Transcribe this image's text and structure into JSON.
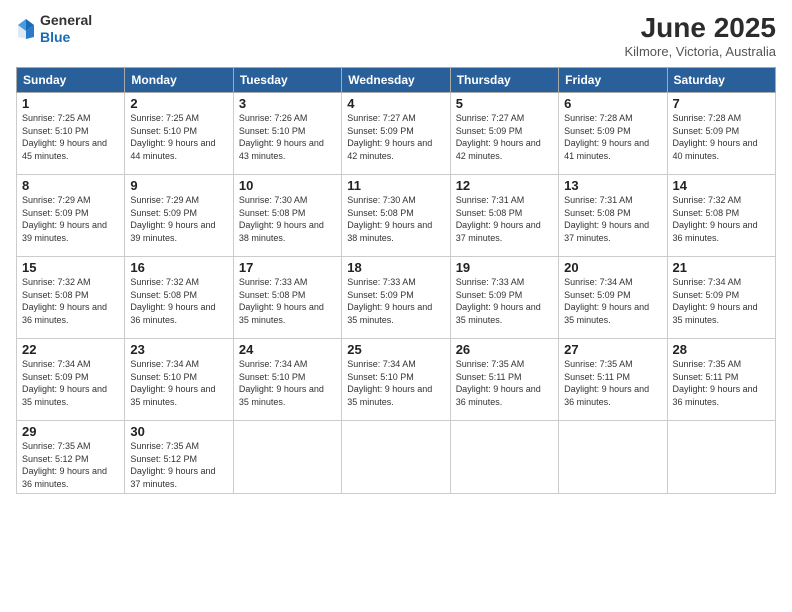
{
  "header": {
    "logo_line1": "General",
    "logo_line2": "Blue",
    "month_title": "June 2025",
    "subtitle": "Kilmore, Victoria, Australia"
  },
  "days_of_week": [
    "Sunday",
    "Monday",
    "Tuesday",
    "Wednesday",
    "Thursday",
    "Friday",
    "Saturday"
  ],
  "weeks": [
    [
      {
        "day": "1",
        "sunrise": "7:25 AM",
        "sunset": "5:10 PM",
        "daylight": "9 hours and 45 minutes."
      },
      {
        "day": "2",
        "sunrise": "7:25 AM",
        "sunset": "5:10 PM",
        "daylight": "9 hours and 44 minutes."
      },
      {
        "day": "3",
        "sunrise": "7:26 AM",
        "sunset": "5:10 PM",
        "daylight": "9 hours and 43 minutes."
      },
      {
        "day": "4",
        "sunrise": "7:27 AM",
        "sunset": "5:09 PM",
        "daylight": "9 hours and 42 minutes."
      },
      {
        "day": "5",
        "sunrise": "7:27 AM",
        "sunset": "5:09 PM",
        "daylight": "9 hours and 42 minutes."
      },
      {
        "day": "6",
        "sunrise": "7:28 AM",
        "sunset": "5:09 PM",
        "daylight": "9 hours and 41 minutes."
      },
      {
        "day": "7",
        "sunrise": "7:28 AM",
        "sunset": "5:09 PM",
        "daylight": "9 hours and 40 minutes."
      }
    ],
    [
      {
        "day": "8",
        "sunrise": "7:29 AM",
        "sunset": "5:09 PM",
        "daylight": "9 hours and 39 minutes."
      },
      {
        "day": "9",
        "sunrise": "7:29 AM",
        "sunset": "5:09 PM",
        "daylight": "9 hours and 39 minutes."
      },
      {
        "day": "10",
        "sunrise": "7:30 AM",
        "sunset": "5:08 PM",
        "daylight": "9 hours and 38 minutes."
      },
      {
        "day": "11",
        "sunrise": "7:30 AM",
        "sunset": "5:08 PM",
        "daylight": "9 hours and 38 minutes."
      },
      {
        "day": "12",
        "sunrise": "7:31 AM",
        "sunset": "5:08 PM",
        "daylight": "9 hours and 37 minutes."
      },
      {
        "day": "13",
        "sunrise": "7:31 AM",
        "sunset": "5:08 PM",
        "daylight": "9 hours and 37 minutes."
      },
      {
        "day": "14",
        "sunrise": "7:32 AM",
        "sunset": "5:08 PM",
        "daylight": "9 hours and 36 minutes."
      }
    ],
    [
      {
        "day": "15",
        "sunrise": "7:32 AM",
        "sunset": "5:08 PM",
        "daylight": "9 hours and 36 minutes."
      },
      {
        "day": "16",
        "sunrise": "7:32 AM",
        "sunset": "5:08 PM",
        "daylight": "9 hours and 36 minutes."
      },
      {
        "day": "17",
        "sunrise": "7:33 AM",
        "sunset": "5:08 PM",
        "daylight": "9 hours and 35 minutes."
      },
      {
        "day": "18",
        "sunrise": "7:33 AM",
        "sunset": "5:09 PM",
        "daylight": "9 hours and 35 minutes."
      },
      {
        "day": "19",
        "sunrise": "7:33 AM",
        "sunset": "5:09 PM",
        "daylight": "9 hours and 35 minutes."
      },
      {
        "day": "20",
        "sunrise": "7:34 AM",
        "sunset": "5:09 PM",
        "daylight": "9 hours and 35 minutes."
      },
      {
        "day": "21",
        "sunrise": "7:34 AM",
        "sunset": "5:09 PM",
        "daylight": "9 hours and 35 minutes."
      }
    ],
    [
      {
        "day": "22",
        "sunrise": "7:34 AM",
        "sunset": "5:09 PM",
        "daylight": "9 hours and 35 minutes."
      },
      {
        "day": "23",
        "sunrise": "7:34 AM",
        "sunset": "5:10 PM",
        "daylight": "9 hours and 35 minutes."
      },
      {
        "day": "24",
        "sunrise": "7:34 AM",
        "sunset": "5:10 PM",
        "daylight": "9 hours and 35 minutes."
      },
      {
        "day": "25",
        "sunrise": "7:34 AM",
        "sunset": "5:10 PM",
        "daylight": "9 hours and 35 minutes."
      },
      {
        "day": "26",
        "sunrise": "7:35 AM",
        "sunset": "5:11 PM",
        "daylight": "9 hours and 36 minutes."
      },
      {
        "day": "27",
        "sunrise": "7:35 AM",
        "sunset": "5:11 PM",
        "daylight": "9 hours and 36 minutes."
      },
      {
        "day": "28",
        "sunrise": "7:35 AM",
        "sunset": "5:11 PM",
        "daylight": "9 hours and 36 minutes."
      }
    ],
    [
      {
        "day": "29",
        "sunrise": "7:35 AM",
        "sunset": "5:12 PM",
        "daylight": "9 hours and 36 minutes."
      },
      {
        "day": "30",
        "sunrise": "7:35 AM",
        "sunset": "5:12 PM",
        "daylight": "9 hours and 37 minutes."
      },
      null,
      null,
      null,
      null,
      null
    ]
  ]
}
